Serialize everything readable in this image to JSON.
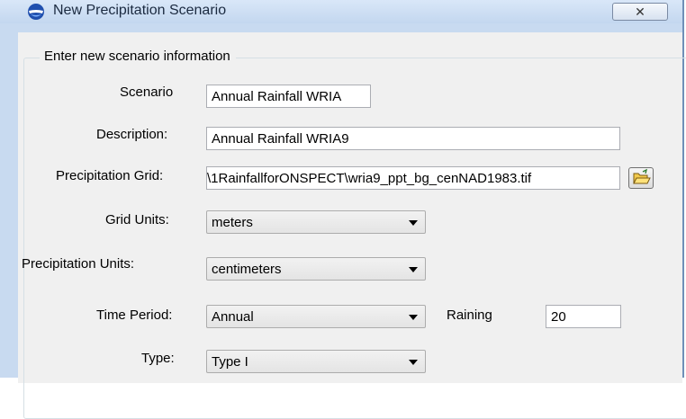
{
  "window": {
    "title": "New Precipitation Scenario",
    "close_glyph": "✕"
  },
  "group": {
    "legend": "Enter new scenario information"
  },
  "fields": {
    "scenario": {
      "label": "Scenario",
      "value": "Annual Rainfall WRIA"
    },
    "description": {
      "label": "Description:",
      "value": "Annual Rainfall WRIA9"
    },
    "precip_grid": {
      "label": "Precipitation Grid:",
      "value": "\\1RainfallforONSPECT\\wria9_ppt_bg_cenNAD1983.tif"
    },
    "grid_units": {
      "label": "Grid Units:",
      "value": "meters"
    },
    "precip_units": {
      "label": "Precipitation Units:",
      "value": "centimeters"
    },
    "time_period": {
      "label": "Time Period:",
      "value": "Annual"
    },
    "raining": {
      "label": "Raining",
      "value": "20"
    },
    "type": {
      "label": "Type:",
      "value": "Type I"
    }
  },
  "icons": {
    "app": "noaa-logo-icon",
    "browse": "open-folder-icon",
    "dropdown": "chevron-down-icon"
  },
  "colors": {
    "title_bar": "#c8daf0",
    "dialog_bg": "#f0f0f0"
  }
}
